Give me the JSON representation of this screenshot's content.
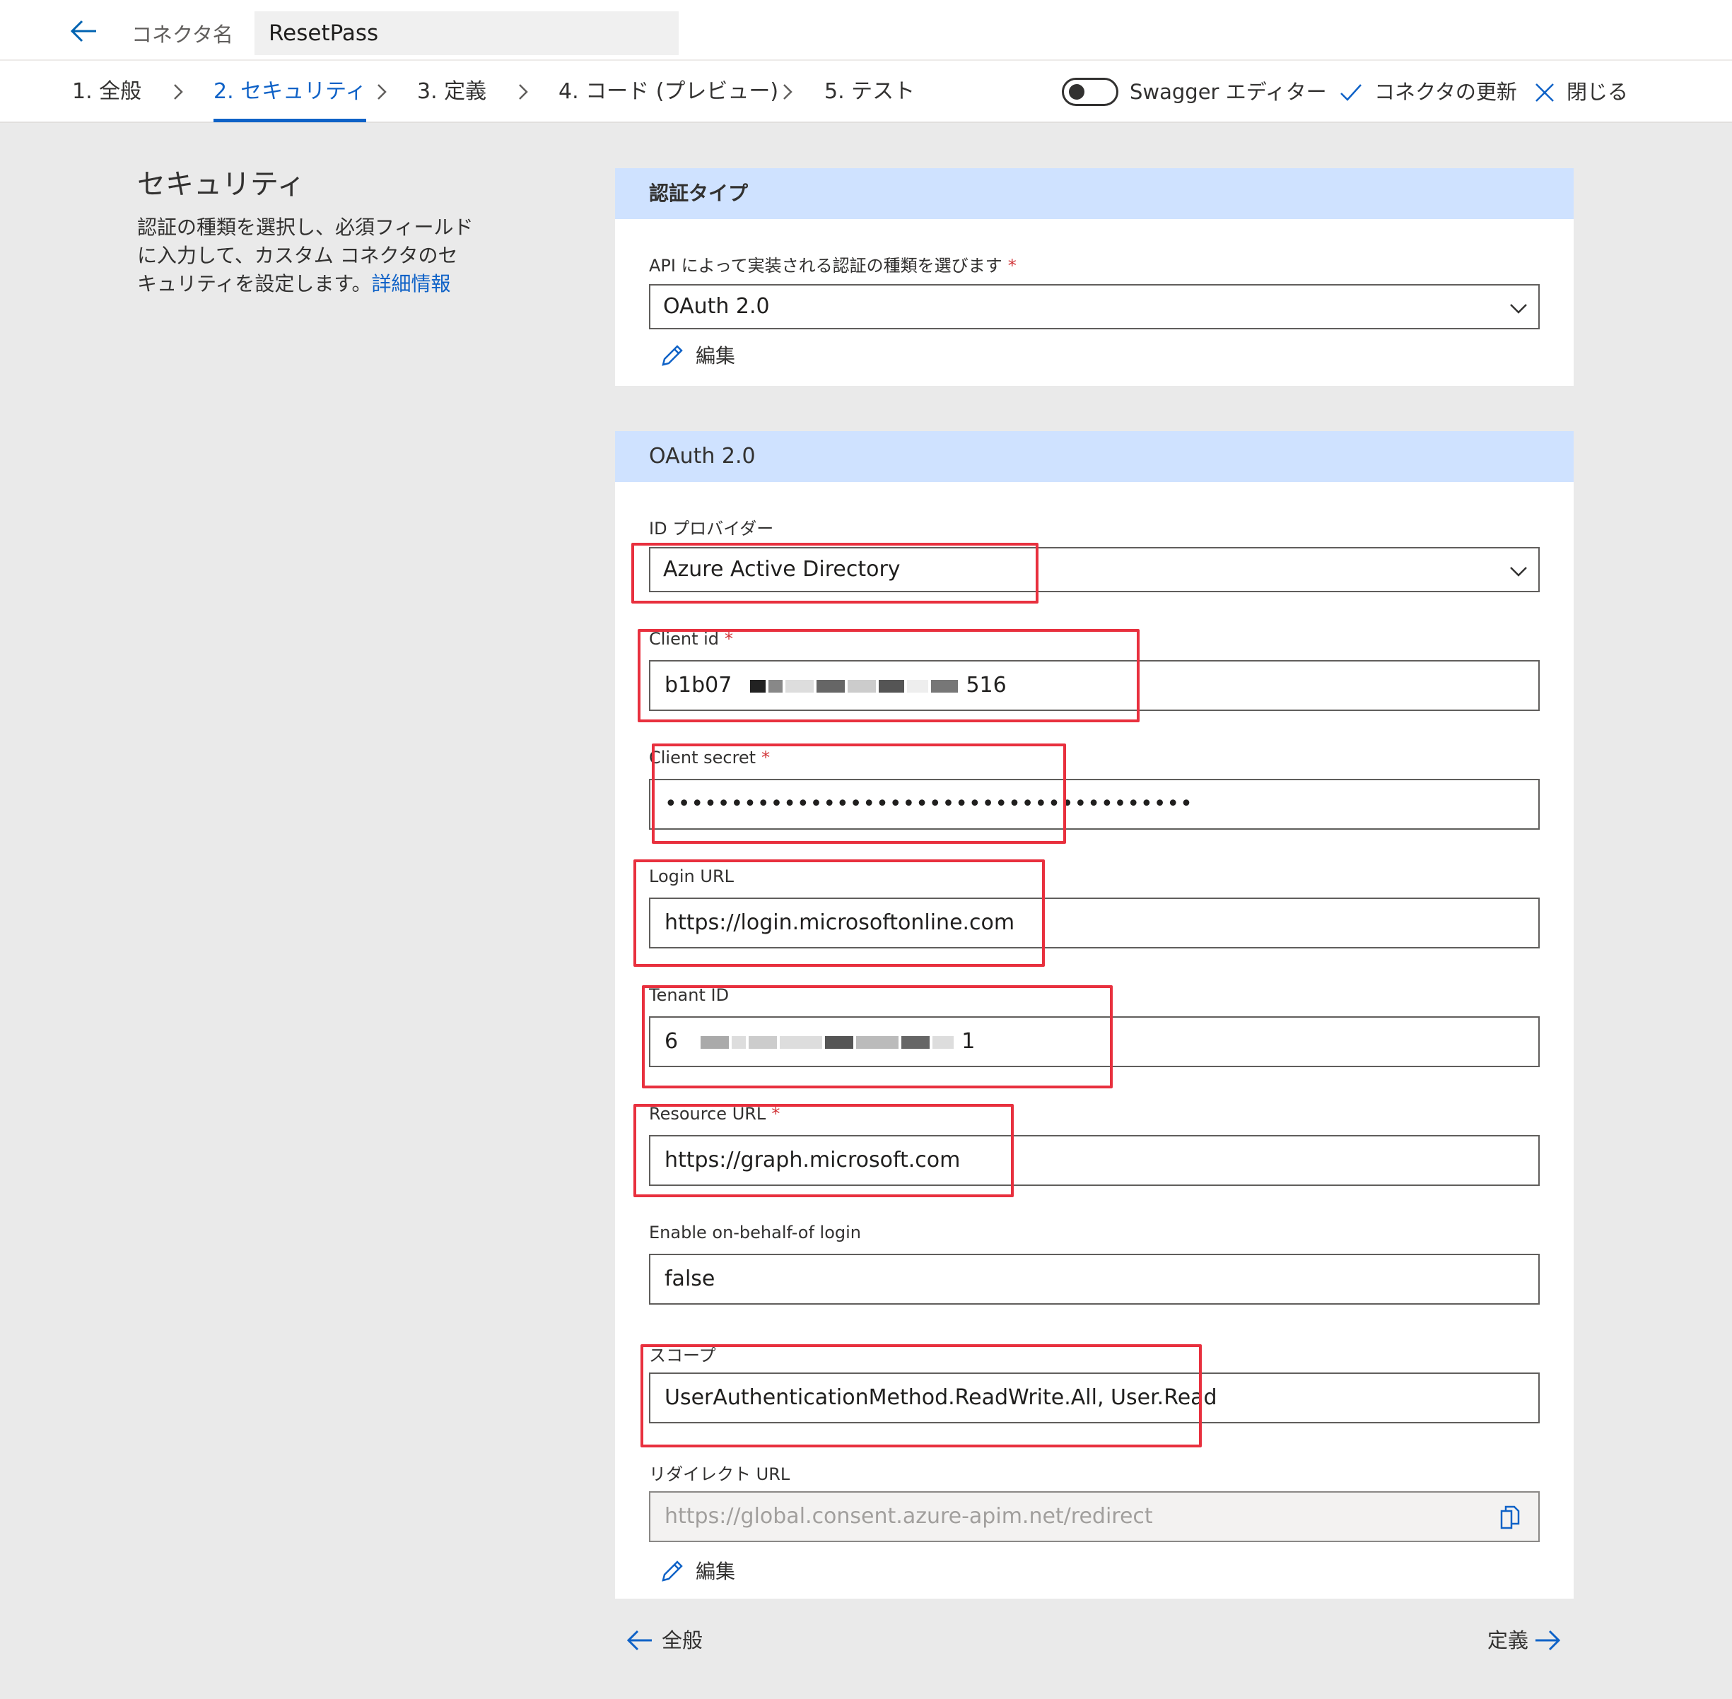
{
  "header": {
    "connector_label": "コネクタ名",
    "connector_name": "ResetPass"
  },
  "steps": [
    {
      "label": "1. 全般",
      "active": false
    },
    {
      "label": "2. セキュリティ",
      "active": true
    },
    {
      "label": "3. 定義",
      "active": false
    },
    {
      "label": "4. コード (プレビュー)",
      "active": false
    },
    {
      "label": "5. テスト",
      "active": false
    }
  ],
  "toolbar": {
    "swagger_label": "Swagger エディター",
    "swagger_on": false,
    "update_label": "コネクタの更新",
    "close_label": "閉じる"
  },
  "sidebar": {
    "title": "セキュリティ",
    "description": "認証の種類を選択し、必須フィールドに入力して、カスタム コネクタのセキュリティを設定します。",
    "link": "詳細情報"
  },
  "auth_card": {
    "header": "認証タイプ",
    "select_label": "API によって実装される認証の種類を選びます",
    "selected": "OAuth 2.0",
    "edit_label": "編集"
  },
  "oauth_card": {
    "header": "OAuth 2.0",
    "identity_provider_label": "ID プロバイダー",
    "identity_provider_value": "Azure Active Directory",
    "client_id_label": "Client id",
    "client_id_start": "b1b07",
    "client_id_end": "516",
    "client_secret_label": "Client secret",
    "client_secret_value": "••••••••••••••••••••••••••••••••••••••••",
    "login_url_label": "Login URL",
    "login_url_value": "https://login.microsoftonline.com",
    "tenant_id_label": "Tenant ID",
    "tenant_id_start": "6",
    "tenant_id_end": "1",
    "resource_url_label": "Resource URL",
    "resource_url_value": "https://graph.microsoft.com",
    "obo_label": "Enable on-behalf-of login",
    "obo_value": "false",
    "scope_label": "スコープ",
    "scope_value": "UserAuthenticationMethod.ReadWrite.All, User.Read",
    "redirect_label": "リダイレクト URL",
    "redirect_value": "https://global.consent.azure-apim.net/redirect",
    "edit_label": "編集"
  },
  "footer": {
    "prev_label": "全般",
    "next_label": "定義"
  },
  "colors": {
    "accent": "#0f62c7",
    "header_band": "#cfe2ff",
    "highlight": "#e8303e",
    "required": "#d13438"
  },
  "icons": [
    "back-arrow-icon",
    "chevron-right-icon",
    "checkmark-icon",
    "close-icon",
    "pencil-icon",
    "chevron-down-icon",
    "copy-icon",
    "arrow-left-icon",
    "arrow-right-icon"
  ]
}
